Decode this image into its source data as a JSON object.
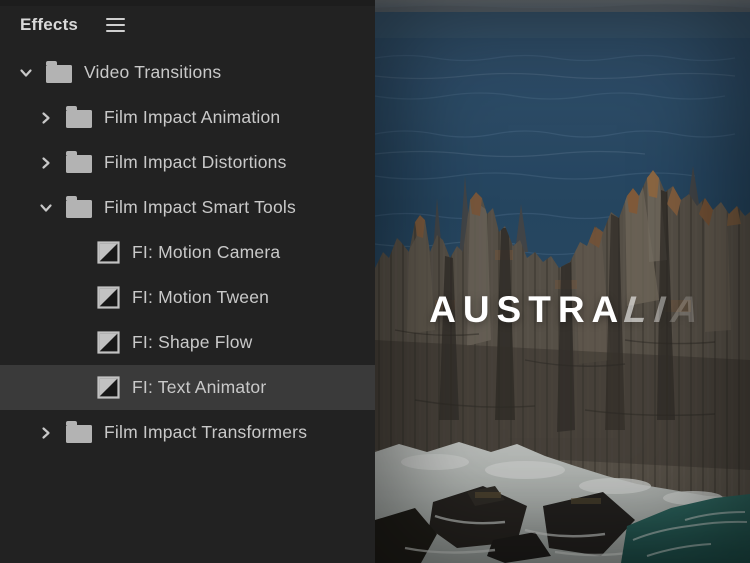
{
  "panel": {
    "title": "Effects",
    "menu_icon": "hamburger-icon"
  },
  "tree": {
    "items": [
      {
        "label": "Video Transitions",
        "type": "folder",
        "level": 1,
        "state": "expanded",
        "selected": false
      },
      {
        "label": "Film Impact Animation",
        "type": "folder",
        "level": 2,
        "state": "collapsed",
        "selected": false
      },
      {
        "label": "Film Impact Distortions",
        "type": "folder",
        "level": 2,
        "state": "collapsed",
        "selected": false
      },
      {
        "label": "Film Impact Smart Tools",
        "type": "folder",
        "level": 2,
        "state": "expanded",
        "selected": false
      },
      {
        "label": "FI: Motion Camera",
        "type": "transition",
        "level": 3,
        "selected": false
      },
      {
        "label": "FI: Motion Tween",
        "type": "transition",
        "level": 3,
        "selected": false
      },
      {
        "label": "FI: Shape Flow",
        "type": "transition",
        "level": 3,
        "selected": false
      },
      {
        "label": "FI: Text Animator",
        "type": "transition",
        "level": 3,
        "selected": true
      },
      {
        "label": "Film Impact Transformers",
        "type": "folder",
        "level": 2,
        "state": "collapsed",
        "selected": false
      }
    ]
  },
  "preview": {
    "description": "Aerial video frame of dolerite sea-cliff columns and ocean with animated title",
    "overlay_title": {
      "word": "AUSTRALIA",
      "solid": "AUSTRA",
      "fading": [
        "L",
        "I",
        "A"
      ]
    },
    "colors": {
      "panel_bg": "#222222",
      "panel_selected_bg": "#3a3a3a",
      "panel_text": "#c9c9c9",
      "icon_gray": "#b3b3b3",
      "sea_blue": "#2f5674",
      "sky_haze": "#848d92",
      "rock_gray": "#665e52",
      "rock_warm": "#9a6c44",
      "foam_white": "#c9cec9",
      "teal_water": "#2a6a62",
      "title_white": "#ffffff"
    }
  }
}
